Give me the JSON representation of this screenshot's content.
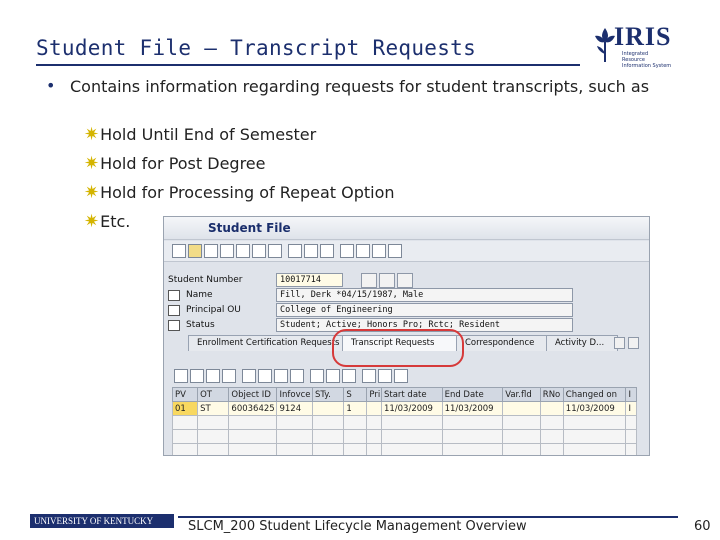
{
  "slide": {
    "title": "Student File – Transcript Requests",
    "bullet": "Contains information regarding requests for student transcripts, such as",
    "sub_items": [
      "Hold Until End of Semester",
      "Hold for Post Degree",
      "Hold for Processing of Repeat Option",
      "Etc."
    ],
    "footer_text": "SLCM_200 Student Lifecycle Management Overview",
    "page_number": "60",
    "footer_logo": "UNIVERSITY OF KENTUCKY",
    "logo": {
      "name": "IRIS",
      "subtitle": "Integrated Resource Information System"
    }
  },
  "sap": {
    "window_title": "Student File",
    "fields": [
      {
        "label": "Student Number",
        "value": "10017714"
      },
      {
        "label": "Name",
        "value": "Fill, Derk *04/15/1987, Male"
      },
      {
        "label": "Principal OU",
        "value": "College of Engineering"
      },
      {
        "label": "Status",
        "value": "Student; Active; Honors Pro; Rctc; Resident"
      }
    ],
    "tabs": [
      {
        "label": "Enrollment Certification Requests"
      },
      {
        "label": "Transcript Requests"
      },
      {
        "label": "Correspondence"
      },
      {
        "label": "Activity D..."
      }
    ],
    "grid": {
      "columns": [
        "PV",
        "OT",
        "Object ID",
        "Infovce",
        "STy.",
        "S",
        "Pri",
        "Start date",
        "End Date",
        "Var.fld",
        "RNo",
        "Changed on",
        "I"
      ],
      "rows": [
        [
          "01",
          "ST",
          "60036425",
          "9124",
          "",
          "1",
          "",
          "11/03/2009",
          "11/03/2009",
          "",
          "",
          "11/03/2009",
          "I"
        ]
      ]
    }
  },
  "colors": {
    "title": "#1c2f6e",
    "highlight": "#d63a3a",
    "star": "#d4b400"
  }
}
